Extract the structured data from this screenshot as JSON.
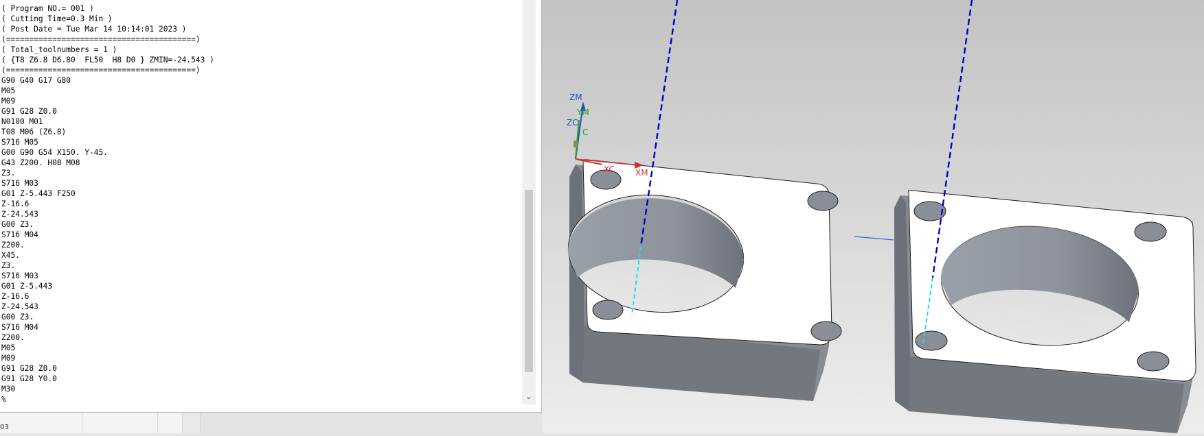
{
  "nc_program": {
    "lines": [
      "( Program NO.= 001 )",
      "( Cutting Time=0.3 Min )",
      "( Post Date = Tue Mar 14 10:14:01 2023 )",
      "(=========================================)",
      "( Total_toolnumbers = 1 )",
      "( {T8 Z6.8 D6.80  FL50  H8 D0 } ZMIN=-24.543 )",
      "(=========================================)",
      "G90 G40 G17 G80",
      "M05",
      "M09",
      "G91 G28 Z0.0",
      "N0100 M01",
      "T08 M06 (Z6.8)",
      "S716 M05",
      "G00 G90 G54 X150. Y-45.",
      "G43 Z200. H08 M08",
      "Z3.",
      "S716 M03",
      "G01 Z-5.443 F250",
      "Z-16.6",
      "Z-24.543",
      "G00 Z3.",
      "S716 M04",
      "Z200.",
      "X45.",
      "Z3.",
      "S716 M03",
      "G01 Z-5.443",
      "Z-16.6",
      "Z-24.543",
      "G00 Z3.",
      "S716 M04",
      "Z200.",
      "M05",
      "M09",
      "G91 G28 Z0.0",
      "G91 G28 Y0.0",
      "M30",
      "%"
    ]
  },
  "bottom_strip": {
    "label": "03"
  },
  "viewport": {
    "axis_labels": {
      "zm": "ZM",
      "ym": "YM",
      "zc": "ZC",
      "yc": "C",
      "xc": "XC",
      "xm": "XM"
    },
    "colors": {
      "part_top": "#ffffff",
      "part_side": "#7a7f87",
      "bore_wall": "#9aa0a8",
      "toolpath_rapid": "#0000cc",
      "toolpath_feed": "#19e0f0",
      "axis_x": "#d03030",
      "axis_y": "#20a020",
      "axis_z": "#2050c0"
    }
  },
  "scrollbar": {
    "down_arrow_icon": "chevron-down-icon"
  }
}
